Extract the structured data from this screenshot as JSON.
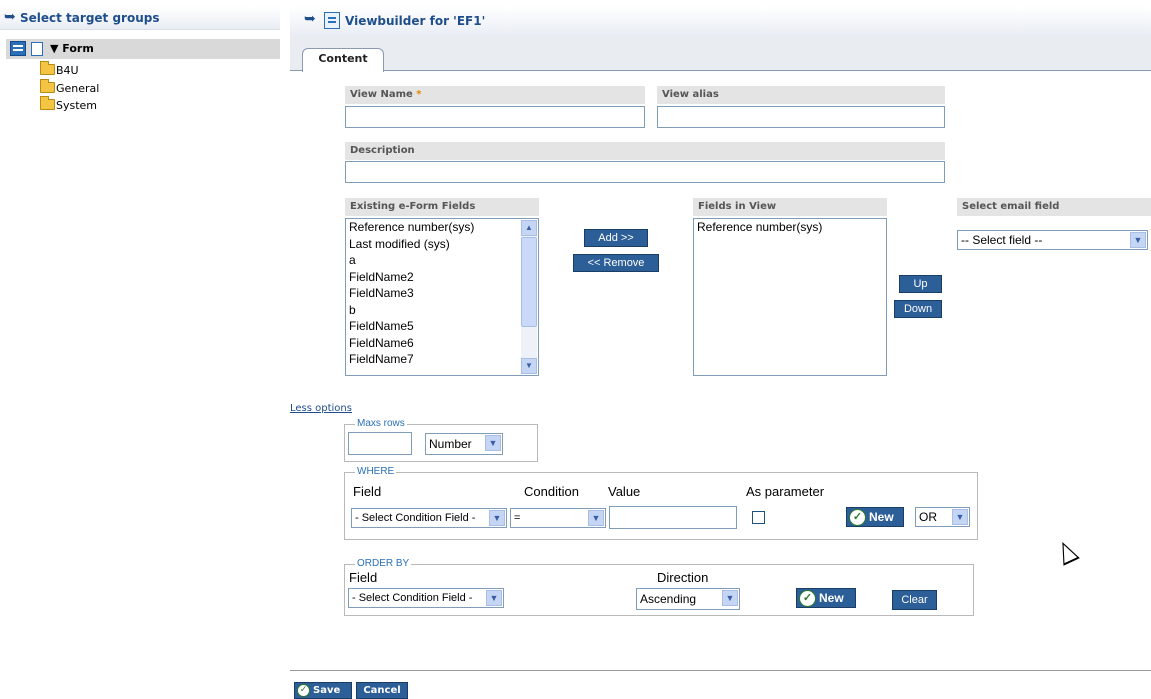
{
  "left_panel": {
    "title": "Select target groups",
    "tree_root": "Form",
    "tree_items": [
      "B4U",
      "General",
      "System"
    ]
  },
  "header": {
    "title": "Viewbuilder for 'EF1'"
  },
  "tabs": [
    "Content"
  ],
  "form": {
    "view_name_label": "View Name",
    "required_mark": "*",
    "view_alias_label": "View alias",
    "description_label": "Description",
    "existing_fields_label": "Existing e-Form Fields",
    "existing_fields": [
      "Reference number(sys)",
      "Last modified (sys)",
      "a",
      "FieldName2",
      "FieldName3",
      "b",
      "FieldName5",
      "FieldName6",
      "FieldName7"
    ],
    "add_label": "Add >>",
    "remove_label": "<< Remove",
    "fields_in_view_label": "Fields in View",
    "fields_in_view": [
      "Reference number(sys)"
    ],
    "up_label": "Up",
    "down_label": "Down",
    "email_field_label": "Select email field",
    "email_field_value": "-- Select field --"
  },
  "options": {
    "less_options": "Less options",
    "max_rows_legend": "Maxs rows",
    "max_rows_type": "Number",
    "where_legend": "WHERE",
    "field_header": "Field",
    "condition_header": "Condition",
    "value_header": "Value",
    "as_parameter_header": "As parameter",
    "where_field_value": "- Select Condition Field -",
    "where_condition_value": "=",
    "where_new_label": "New",
    "logic_value": "OR",
    "orderby_legend": "ORDER BY",
    "orderby_field_header": "Field",
    "direction_header": "Direction",
    "orderby_field_value": "- Select Condition Field -",
    "direction_value": "Ascending",
    "orderby_new_label": "New",
    "clear_label": "Clear"
  },
  "footer": {
    "save_label": "Save",
    "cancel_label": "Cancel"
  },
  "colors": {
    "accent": "#1f4e8c",
    "button": "#2c5e97"
  }
}
